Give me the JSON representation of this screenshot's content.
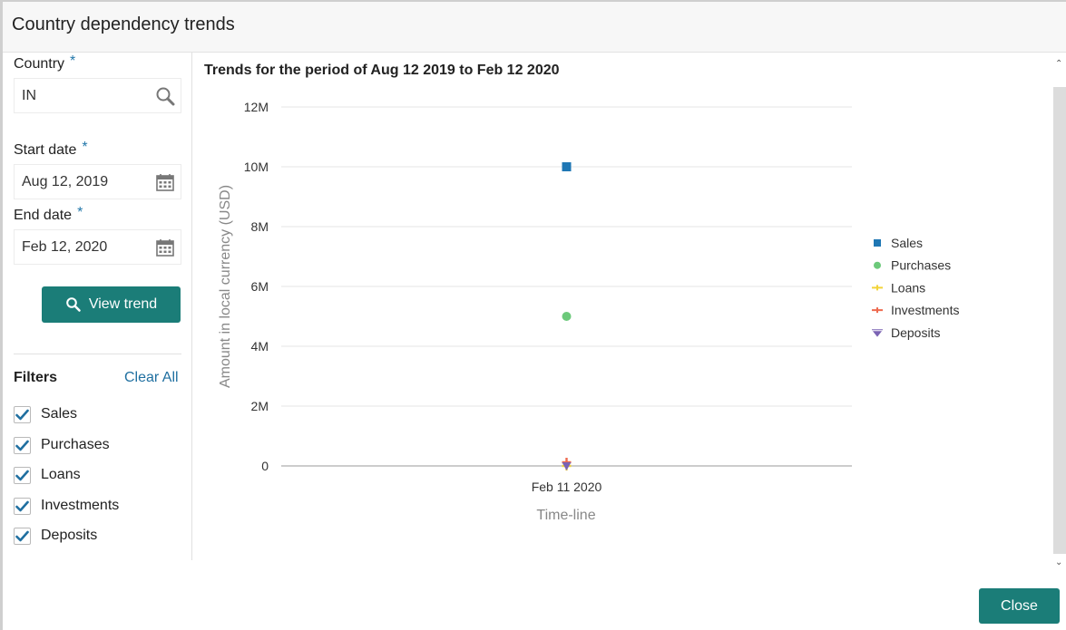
{
  "dialog": {
    "title": "Country dependency trends",
    "close_label": "Close"
  },
  "form": {
    "country": {
      "label": "Country",
      "value": "IN",
      "required_mark": "*",
      "icon": "search-icon"
    },
    "start_date": {
      "label": "Start date",
      "value": "Aug 12, 2019",
      "required_mark": "*",
      "icon": "calendar-icon"
    },
    "end_date": {
      "label": "End date",
      "value": "Feb 12, 2020",
      "required_mark": "*",
      "icon": "calendar-icon"
    },
    "view_trend_label": "View trend"
  },
  "filters": {
    "title": "Filters",
    "clear_all_label": "Clear All",
    "items": [
      {
        "label": "Sales",
        "checked": true
      },
      {
        "label": "Purchases",
        "checked": true
      },
      {
        "label": "Loans",
        "checked": true
      },
      {
        "label": "Investments",
        "checked": true
      },
      {
        "label": "Deposits",
        "checked": true
      }
    ]
  },
  "chart_header": {
    "title": "Trends for the period of Aug 12 2019 to Feb 12 2020"
  },
  "colors": {
    "accent": "#1b7d78",
    "link": "#1f6fa0",
    "checkmark": "#1f6fa0"
  },
  "chart_data": {
    "type": "scatter",
    "categories": [
      "Feb 11 2020"
    ],
    "xlabel": "Time-line",
    "ylabel": "Amount in local currency (USD)",
    "ylim": [
      0,
      12000000
    ],
    "y_ticks": [
      0,
      2000000,
      4000000,
      6000000,
      8000000,
      10000000,
      12000000
    ],
    "y_tick_labels": [
      "0",
      "2M",
      "4M",
      "6M",
      "8M",
      "10M",
      "12M"
    ],
    "grid": true,
    "legend_position": "right",
    "series": [
      {
        "name": "Sales",
        "values": [
          10000000
        ],
        "color": "#1f77b4",
        "marker": "square"
      },
      {
        "name": "Purchases",
        "values": [
          5000000
        ],
        "color": "#6cc97a",
        "marker": "circle"
      },
      {
        "name": "Loans",
        "values": [
          0
        ],
        "color": "#f2d43a",
        "marker": "cross"
      },
      {
        "name": "Investments",
        "values": [
          0
        ],
        "color": "#ee6a4f",
        "marker": "plus"
      },
      {
        "name": "Deposits",
        "values": [
          0
        ],
        "color": "#7b63b3",
        "marker": "triangle-down"
      }
    ]
  }
}
